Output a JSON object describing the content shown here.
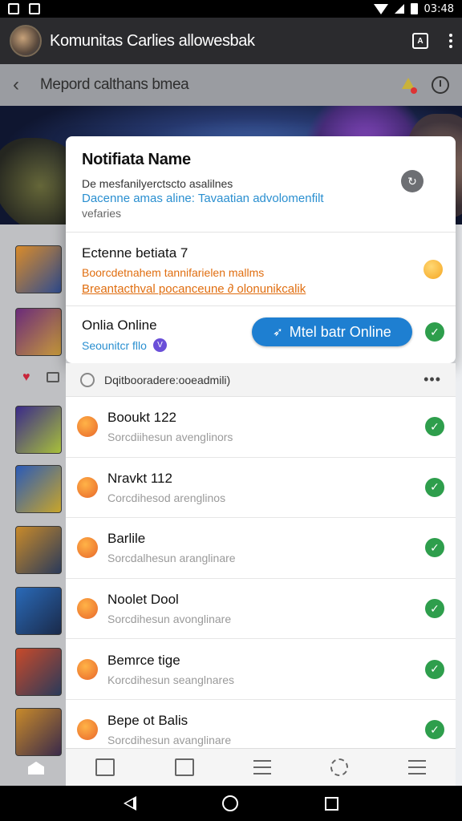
{
  "status_bar": {
    "time": "03:48"
  },
  "app_bar": {
    "title": "Komunitas Carlies allowesbak",
    "square_icon_label": "A"
  },
  "sub_bar": {
    "title": "Mepord calthans bmea",
    "back_glyph": "‹"
  },
  "notification": {
    "title": "Notifiata Name",
    "line1": "De mesfanilyerctscto asalilnes",
    "line2": "Dacenne amas aline: Tavaatian advolomenfilt",
    "line3": "vefaries",
    "badge_glyph": "↻",
    "event": {
      "title": "Ectenne betiata 7",
      "line1": "Boorcdetnahem tannifarielen mallms",
      "line2": "Breantacthval pocanceune ∂ olonunikcalik"
    },
    "online": {
      "title": "Onlia Online",
      "subtitle": "Seounitcr fllo",
      "v_badge": "V",
      "button_label": "Mtel batr Online",
      "button_icon": "➶"
    }
  },
  "panel": {
    "header_text": "Dqitbooradere:ooeadmili)",
    "more_glyph": "•••",
    "rows": [
      {
        "name": "Booukt 122",
        "sub": "Sorcdiihesun avenglinors"
      },
      {
        "name": "Nravkt 112",
        "sub": "Corcdihesod arenglinos"
      },
      {
        "name": "Barlile",
        "sub": "Sorcdalhesun aranglinare"
      },
      {
        "name": "Noolet Dool",
        "sub": "Sorcdihesun avonglinare"
      },
      {
        "name": "Bemrce tige",
        "sub": "Korcdihesun seanglnares"
      },
      {
        "name": "Bepe ot Balis",
        "sub": "Sorcdihesun avanglinare"
      }
    ]
  },
  "check_glyph": "✓",
  "left_heart_glyph": "♥",
  "colors": {
    "accent_blue": "#1e7fd1",
    "link_blue": "#2a8fd0",
    "orange": "#e06e10",
    "green_check": "#2e9e4c"
  },
  "left_thumbnails": [
    {
      "colors": [
        "#d98b2a",
        "#2f4c8f"
      ]
    },
    {
      "colors": [
        "#6a2a7a",
        "#c79a3a"
      ]
    },
    {
      "colors": [
        "#3a2a8a",
        "#a8c03a"
      ]
    },
    {
      "colors": [
        "#2a5ab8",
        "#c8a52a"
      ]
    },
    {
      "colors": [
        "#c88a2a",
        "#2a3a5a"
      ]
    },
    {
      "colors": [
        "#2a6ab8",
        "#1a2a4a"
      ]
    },
    {
      "colors": [
        "#c84a2a",
        "#2a3a5a"
      ]
    },
    {
      "colors": [
        "#c88a2a",
        "#3a2a4a"
      ]
    }
  ]
}
